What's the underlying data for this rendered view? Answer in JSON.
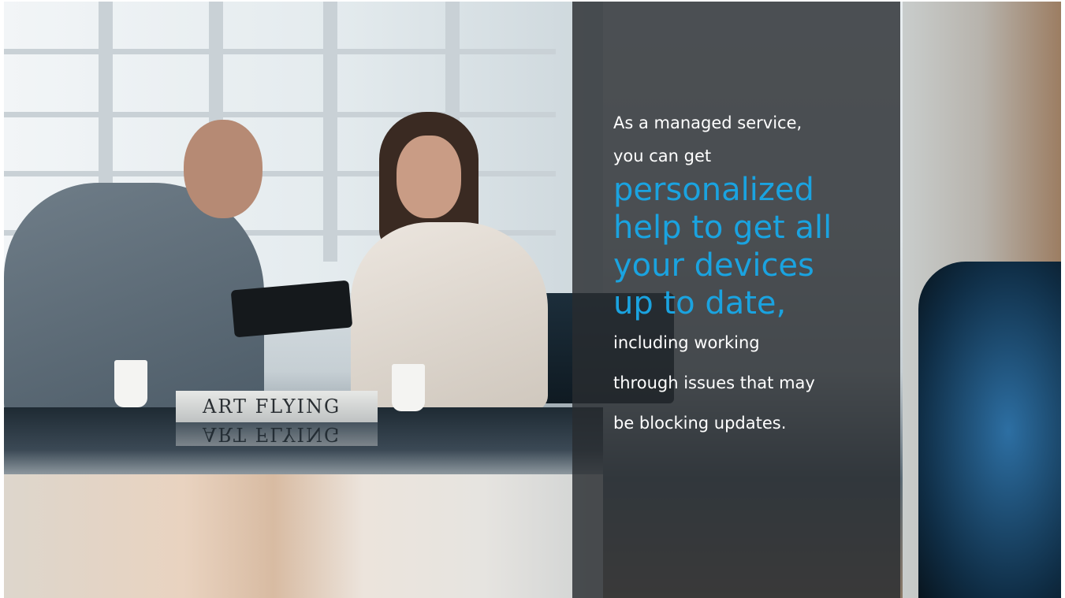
{
  "panel": {
    "intro_lines": [
      "As a managed service,",
      "you can get"
    ],
    "highlight_lines": [
      "personalized",
      "help to get all",
      "your devices",
      "up to date,"
    ],
    "closing_lines": [
      "including working",
      "through issues that may",
      "be blocking updates."
    ]
  },
  "photo": {
    "book_title": "ART FLYING"
  },
  "colors": {
    "highlight": "#1aa3e0",
    "panel_overlay": "#282c2f",
    "body_text": "#ffffff"
  }
}
